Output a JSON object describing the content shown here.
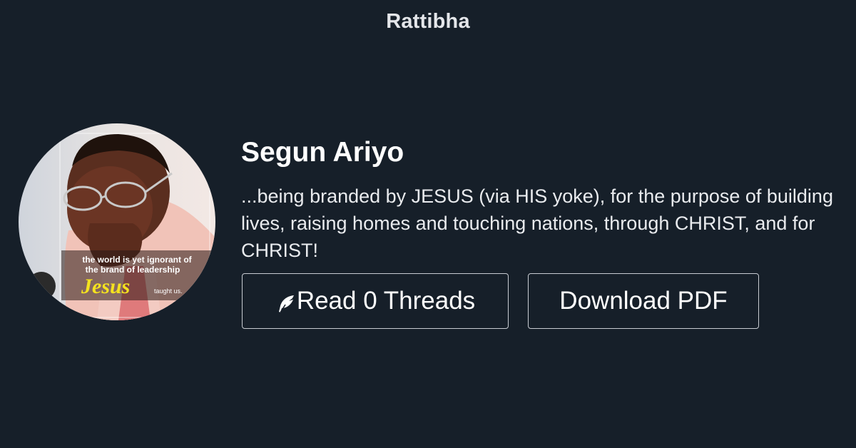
{
  "site": {
    "brand": "Rattibha"
  },
  "profile": {
    "name": "Segun Ariyo",
    "bio": "...being branded by JESUS (via HIS yoke), for the purpose of building lives, raising homes and touching nations, through CHRIST, and for CHRIST!",
    "avatar_text": {
      "line1": "the world is yet ignorant of",
      "line2": "the brand of leadership",
      "line3": "Jesus",
      "line4": "taught us."
    }
  },
  "actions": {
    "read_label": "Read 0 Threads",
    "read_icon": "feather-icon",
    "pdf_label": "Download PDF"
  },
  "colors": {
    "background": "#161f29",
    "text": "#ffffff",
    "button_border": "#c8ccd2"
  }
}
